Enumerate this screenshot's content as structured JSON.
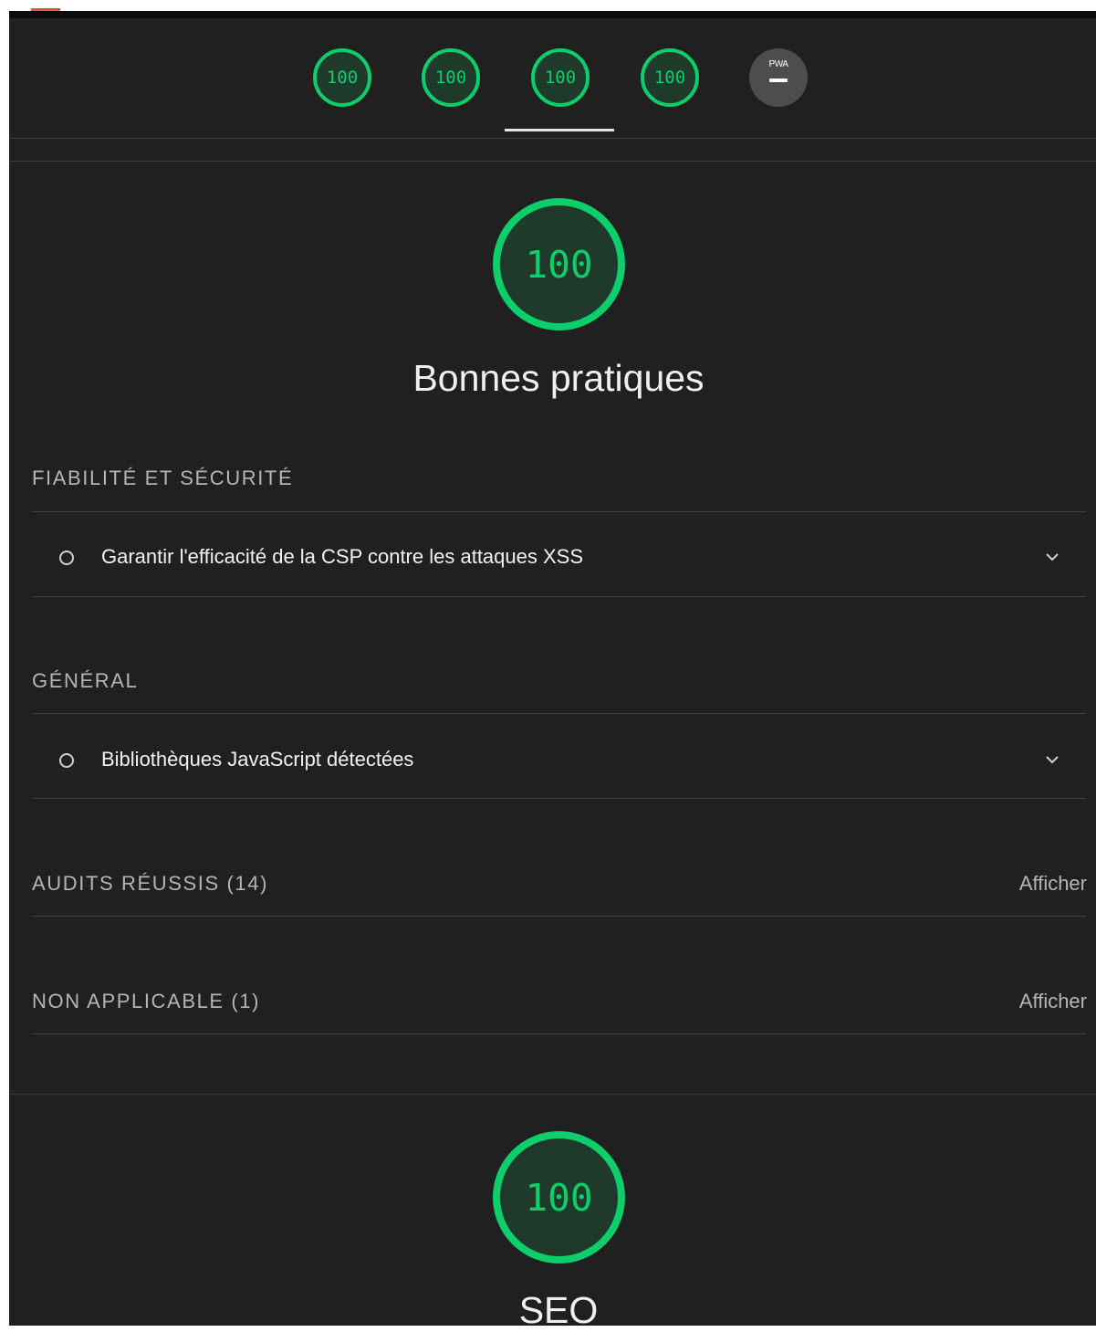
{
  "header": {
    "gauges": [
      {
        "name": "gauge-tab-performance",
        "score": "100"
      },
      {
        "name": "gauge-tab-accessibility",
        "score": "100"
      },
      {
        "name": "gauge-tab-best-practices",
        "score": "100"
      },
      {
        "name": "gauge-tab-seo",
        "score": "100"
      }
    ],
    "pwa": {
      "label": "PWA",
      "icon": "dash-icon"
    },
    "active_tab": "gauge-tab-best-practices"
  },
  "best_practices": {
    "score": "100",
    "title": "Bonnes pratiques",
    "groups": [
      {
        "title": "FIABILITÉ ET SÉCURITÉ",
        "audits": [
          {
            "label": "Garantir l'efficacité de la CSP contre les attaques XSS",
            "status": "informative"
          }
        ]
      },
      {
        "title": "GÉNÉRAL",
        "audits": [
          {
            "label": "Bibliothèques JavaScript détectées",
            "status": "informative"
          }
        ]
      }
    ],
    "passed": {
      "title": "AUDITS RÉUSSIS (14)",
      "link": "Afficher"
    },
    "not_applicable": {
      "title": "NON APPLICABLE (1)",
      "link": "Afficher"
    }
  },
  "seo": {
    "score": "100",
    "title": "SEO"
  },
  "colors": {
    "background": "#202020",
    "pass_green": "#0cce6b",
    "gauge_fill": "#1f3a2a",
    "text_primary": "#f2f2f2",
    "text_secondary": "#b5b5b5",
    "divider": "#424242",
    "pwa_gray": "#4d4d4d"
  }
}
